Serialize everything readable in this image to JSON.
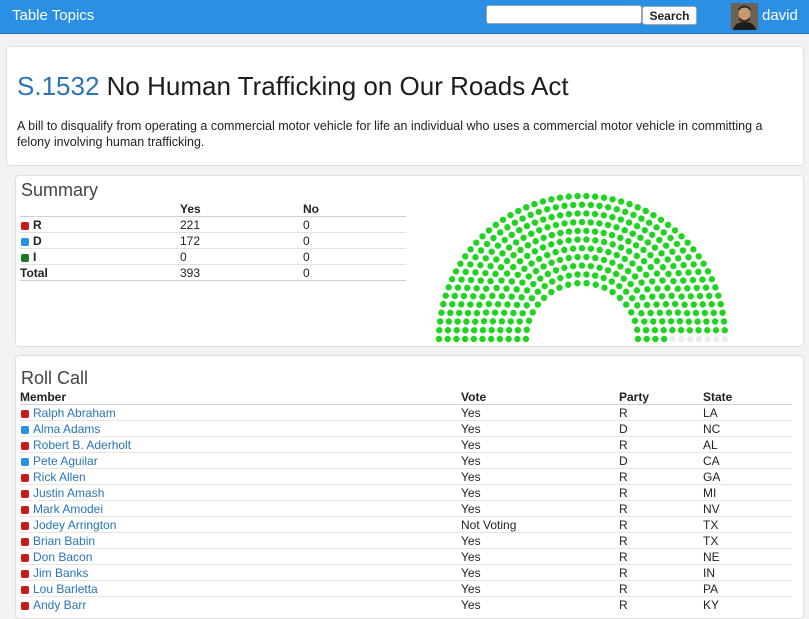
{
  "app": {
    "title": "Table Topics"
  },
  "search": {
    "placeholder": "",
    "button_label": "Search"
  },
  "user": {
    "name": "david"
  },
  "bill": {
    "number": "S.1532",
    "title": "No Human Trafficking on Our Roads Act",
    "description": "A bill to disqualify from operating a commercial motor vehicle for life an individual who uses a commercial motor vehicle in committing a felony involving human trafficking."
  },
  "summary": {
    "title": "Summary",
    "headers": {
      "party": "",
      "yes": "Yes",
      "no": "No"
    },
    "rows": [
      {
        "party": "R",
        "color": "#c81a1a",
        "yes": "221",
        "no": "0"
      },
      {
        "party": "D",
        "color": "#2b8fe3",
        "yes": "172",
        "no": "0"
      },
      {
        "party": "I",
        "color": "#1e7a1e",
        "yes": "0",
        "no": "0"
      }
    ],
    "total": {
      "label": "Total",
      "yes": "393",
      "no": "0"
    }
  },
  "chart_data": {
    "type": "hemicycle",
    "seats": [
      {
        "category": "Yes",
        "count": 393,
        "color": "#1ed41e"
      },
      {
        "category": "Other",
        "count": 42,
        "color": "#ececec"
      }
    ]
  },
  "roll_call": {
    "title": "Roll Call",
    "headers": {
      "member": "Member",
      "vote": "Vote",
      "party": "Party",
      "state": "State"
    },
    "rows": [
      {
        "member": "Ralph Abraham",
        "color": "#c81a1a",
        "vote": "Yes",
        "party": "R",
        "state": "LA"
      },
      {
        "member": "Alma Adams",
        "color": "#2b8fe3",
        "vote": "Yes",
        "party": "D",
        "state": "NC"
      },
      {
        "member": "Robert B. Aderholt",
        "color": "#c81a1a",
        "vote": "Yes",
        "party": "R",
        "state": "AL"
      },
      {
        "member": "Pete Aguilar",
        "color": "#2b8fe3",
        "vote": "Yes",
        "party": "D",
        "state": "CA"
      },
      {
        "member": "Rick Allen",
        "color": "#c81a1a",
        "vote": "Yes",
        "party": "R",
        "state": "GA"
      },
      {
        "member": "Justin Amash",
        "color": "#c81a1a",
        "vote": "Yes",
        "party": "R",
        "state": "MI"
      },
      {
        "member": "Mark Amodei",
        "color": "#c81a1a",
        "vote": "Yes",
        "party": "R",
        "state": "NV"
      },
      {
        "member": "Jodey Arrington",
        "color": "#c81a1a",
        "vote": "Not Voting",
        "party": "R",
        "state": "TX"
      },
      {
        "member": "Brian Babin",
        "color": "#c81a1a",
        "vote": "Yes",
        "party": "R",
        "state": "TX"
      },
      {
        "member": "Don Bacon",
        "color": "#c81a1a",
        "vote": "Yes",
        "party": "R",
        "state": "NE"
      },
      {
        "member": "Jim Banks",
        "color": "#c81a1a",
        "vote": "Yes",
        "party": "R",
        "state": "IN"
      },
      {
        "member": "Lou Barletta",
        "color": "#c81a1a",
        "vote": "Yes",
        "party": "R",
        "state": "PA"
      },
      {
        "member": "Andy Barr",
        "color": "#c81a1a",
        "vote": "Yes",
        "party": "R",
        "state": "KY"
      }
    ]
  }
}
